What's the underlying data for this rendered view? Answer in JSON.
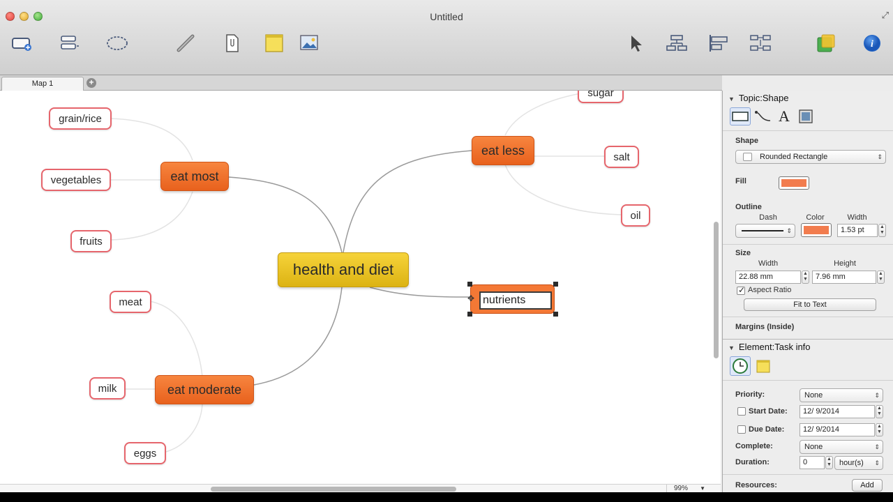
{
  "window": {
    "title": "Untitled"
  },
  "toolbar": {
    "buttons": [
      {
        "name": "topic",
        "icon": "add-topic-icon"
      },
      {
        "name": "subtopic",
        "icon": "subtopic-icon"
      },
      {
        "name": "boundary",
        "icon": "boundary-icon"
      },
      {
        "name": "relationship",
        "icon": "relationship-icon"
      },
      {
        "name": "attachment",
        "icon": "attachment-icon"
      },
      {
        "name": "note",
        "icon": "note-icon"
      },
      {
        "name": "image",
        "icon": "image-icon"
      },
      {
        "name": "select",
        "icon": "pointer-icon"
      },
      {
        "name": "layout",
        "icon": "layout-icon"
      },
      {
        "name": "align",
        "icon": "align-icon"
      },
      {
        "name": "arrange",
        "icon": "arrange-icon"
      },
      {
        "name": "theme",
        "icon": "theme-icon"
      },
      {
        "name": "info",
        "icon": "info-icon"
      }
    ]
  },
  "tabs": [
    {
      "label": "Map 1"
    }
  ],
  "map": {
    "central": "health and diet",
    "branches": [
      {
        "label": "eat most",
        "children": [
          "grain/rice",
          "vegetables",
          "fruits"
        ]
      },
      {
        "label": "eat less",
        "children": [
          "sugar",
          "salt",
          "oil"
        ]
      },
      {
        "label": "eat moderate",
        "children": [
          "meat",
          "milk",
          "eggs"
        ]
      }
    ],
    "editing": {
      "value": "nutrients"
    }
  },
  "zoom": "99%",
  "inspector": {
    "shape_section": {
      "title": "Topic:Shape",
      "shape_label": "Shape",
      "shape_value": "Rounded Rectangle",
      "fill_label": "Fill",
      "fill_color": "#f27c4e",
      "outline_label": "Outline",
      "dash_label": "Dash",
      "color_label": "Color",
      "width_label": "Width",
      "outline_width": "1.53 pt",
      "outline_color": "#f27c4e",
      "size_label": "Size",
      "size_width_label": "Width",
      "size_height_label": "Height",
      "size_width": "22.88 mm",
      "size_height": "7.96 mm",
      "aspect_ratio_label": "Aspect Ratio",
      "fit_button": "Fit to Text",
      "margins_label": "Margins (Inside)"
    },
    "task_section": {
      "title": "Element:Task info",
      "priority_label": "Priority:",
      "priority_value": "None",
      "start_label": "Start Date:",
      "start_value": "12/ 9/2014",
      "due_label": "Due Date:",
      "due_value": "12/ 9/2014",
      "complete_label": "Complete:",
      "complete_value": "None",
      "duration_label": "Duration:",
      "duration_value": "0",
      "duration_unit": "hour(s)",
      "resources_label": "Resources:",
      "add_button": "Add"
    }
  }
}
